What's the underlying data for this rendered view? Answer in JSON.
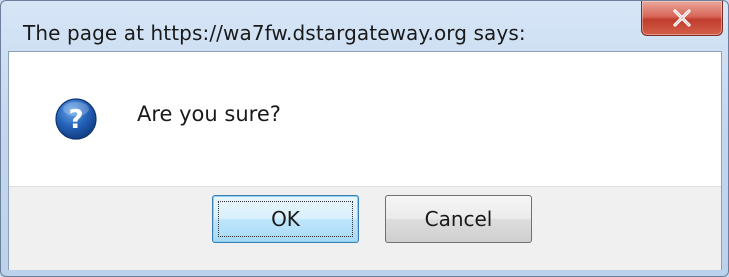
{
  "dialog": {
    "title": "The page at https://wa7fw.dstargateway.org says:",
    "close_icon": "close-icon",
    "message": "Are you sure?",
    "icon": "question-icon",
    "buttons": {
      "ok_label": "OK",
      "cancel_label": "Cancel"
    }
  },
  "colors": {
    "titlebar": "#c3d7ef",
    "close_button": "#c03d2c",
    "ok_focus_border": "#3c7fb1",
    "question_icon_blue": "#1f5fb0"
  }
}
